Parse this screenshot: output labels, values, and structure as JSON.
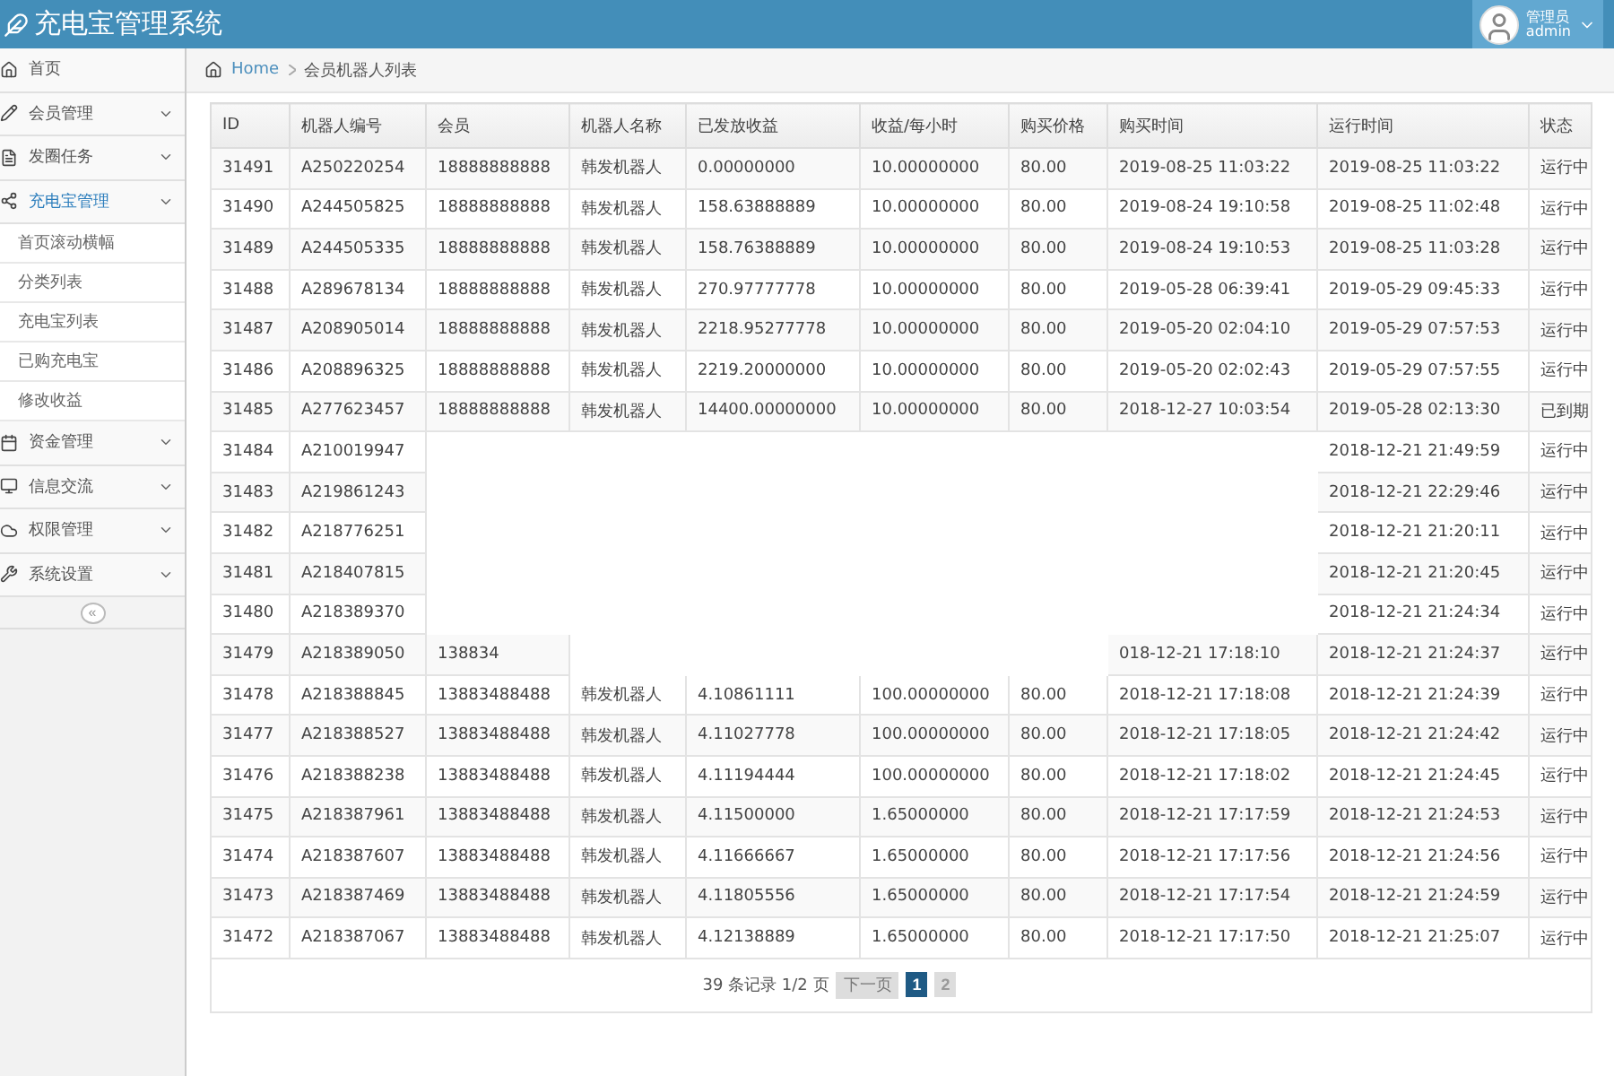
{
  "header": {
    "title": "充电宝管理系统",
    "user_role": "管理员",
    "user_name": "admin"
  },
  "sidebar": {
    "items": [
      {
        "label": "首页",
        "kind": "link",
        "expanded": false
      },
      {
        "label": "会员管理",
        "kind": "group",
        "expanded": false
      },
      {
        "label": "发圈任务",
        "kind": "group",
        "expanded": false
      },
      {
        "label": "充电宝管理",
        "kind": "group",
        "expanded": true,
        "children": [
          {
            "label": "首页滚动横幅"
          },
          {
            "label": "分类列表"
          },
          {
            "label": "充电宝列表"
          },
          {
            "label": "已购充电宝"
          },
          {
            "label": "修改收益"
          }
        ]
      },
      {
        "label": "资金管理",
        "kind": "group",
        "expanded": false
      },
      {
        "label": "信息交流",
        "kind": "group",
        "expanded": false
      },
      {
        "label": "权限管理",
        "kind": "group",
        "expanded": false
      },
      {
        "label": "系统设置",
        "kind": "group",
        "expanded": false
      }
    ],
    "collapse": "«"
  },
  "breadcrumb": [
    "Home",
    "会员机器人列表"
  ],
  "table": {
    "columns": [
      "ID",
      "机器人编号",
      "会员",
      "机器人名称",
      "已发放收益",
      "收益/每小时",
      "购买价格",
      "购买时间",
      "运行时间",
      "状态"
    ],
    "rows": [
      [
        "31491",
        "A250220254",
        "18888888888",
        "韩发机器人",
        "0.00000000",
        "10.00000000",
        "80.00",
        "2019-08-25 11:03:22",
        "2019-08-25 11:03:22",
        "运行中"
      ],
      [
        "31490",
        "A244505825",
        "18888888888",
        "韩发机器人",
        "158.63888889",
        "10.00000000",
        "80.00",
        "2019-08-24 19:10:58",
        "2019-08-25 11:02:48",
        "运行中"
      ],
      [
        "31489",
        "A244505335",
        "18888888888",
        "韩发机器人",
        "158.76388889",
        "10.00000000",
        "80.00",
        "2019-08-24 19:10:53",
        "2019-08-25 11:03:28",
        "运行中"
      ],
      [
        "31488",
        "A289678134",
        "18888888888",
        "韩发机器人",
        "270.97777778",
        "10.00000000",
        "80.00",
        "2019-05-28 06:39:41",
        "2019-05-29 09:45:33",
        "运行中"
      ],
      [
        "31487",
        "A208905014",
        "18888888888",
        "韩发机器人",
        "2218.95277778",
        "10.00000000",
        "80.00",
        "2019-05-20 02:04:10",
        "2019-05-29 07:57:53",
        "运行中"
      ],
      [
        "31486",
        "A208896325",
        "18888888888",
        "韩发机器人",
        "2219.20000000",
        "10.00000000",
        "80.00",
        "2019-05-20 02:02:43",
        "2019-05-29 07:57:55",
        "运行中"
      ],
      [
        "31485",
        "A277623457",
        "18888888888",
        "韩发机器人",
        "14400.00000000",
        "10.00000000",
        "80.00",
        "2018-12-27 10:03:54",
        "2019-05-28 02:13:30",
        "已到期"
      ],
      [
        "31484",
        "A210019947",
        null,
        null,
        null,
        null,
        null,
        null,
        "2018-12-21 21:49:59",
        "运行中"
      ],
      [
        "31483",
        "A219861243",
        null,
        null,
        null,
        null,
        null,
        null,
        "2018-12-21 22:29:46",
        "运行中"
      ],
      [
        "31482",
        "A218776251",
        null,
        null,
        null,
        null,
        null,
        null,
        "2018-12-21 21:20:11",
        "运行中"
      ],
      [
        "31481",
        "A218407815",
        null,
        null,
        null,
        null,
        null,
        null,
        "2018-12-21 21:20:45",
        "运行中"
      ],
      [
        "31480",
        "A218389370",
        null,
        null,
        null,
        null,
        null,
        null,
        "2018-12-21 21:24:34",
        "运行中"
      ],
      [
        "31479",
        "A218389050",
        "138834",
        null,
        null,
        null,
        null,
        "018-12-21 17:18:10",
        "2018-12-21 21:24:37",
        "运行中"
      ],
      [
        "31478",
        "A218388845",
        "13883488488",
        "韩发机器人",
        "4.10861111",
        "100.00000000",
        "80.00",
        "2018-12-21 17:18:08",
        "2018-12-21 21:24:39",
        "运行中"
      ],
      [
        "31477",
        "A218388527",
        "13883488488",
        "韩发机器人",
        "4.11027778",
        "100.00000000",
        "80.00",
        "2018-12-21 17:18:05",
        "2018-12-21 21:24:42",
        "运行中"
      ],
      [
        "31476",
        "A218388238",
        "13883488488",
        "韩发机器人",
        "4.11194444",
        "100.00000000",
        "80.00",
        "2018-12-21 17:18:02",
        "2018-12-21 21:24:45",
        "运行中"
      ],
      [
        "31475",
        "A218387961",
        "13883488488",
        "韩发机器人",
        "4.11500000",
        "1.65000000",
        "80.00",
        "2018-12-21 17:17:59",
        "2018-12-21 21:24:53",
        "运行中"
      ],
      [
        "31474",
        "A218387607",
        "13883488488",
        "韩发机器人",
        "4.11666667",
        "1.65000000",
        "80.00",
        "2018-12-21 17:17:56",
        "2018-12-21 21:24:56",
        "运行中"
      ],
      [
        "31473",
        "A218387469",
        "13883488488",
        "韩发机器人",
        "4.11805556",
        "1.65000000",
        "80.00",
        "2018-12-21 17:17:54",
        "2018-12-21 21:24:59",
        "运行中"
      ],
      [
        "31472",
        "A218387067",
        "13883488488",
        "韩发机器人",
        "4.12138889",
        "1.65000000",
        "80.00",
        "2018-12-21 17:17:50",
        "2018-12-21 21:25:07",
        "运行中"
      ]
    ]
  },
  "pagination": {
    "summary": "39 条记录 1/2 页",
    "next": {
      "label": "下一页",
      "disabled": true
    },
    "pages": [
      {
        "label": "1",
        "selected": true
      },
      {
        "label": "2",
        "selected": false
      }
    ]
  }
}
